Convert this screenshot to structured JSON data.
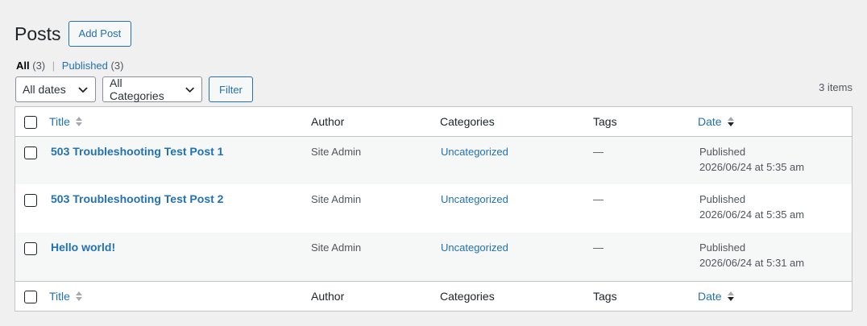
{
  "page": {
    "title": "Posts",
    "add_label": "Add Post"
  },
  "views": {
    "all_label": "All",
    "all_count": "(3)",
    "separator": "|",
    "published_label": "Published",
    "published_count": "(3)"
  },
  "filters": {
    "dates": "All dates",
    "categories": "All Categories",
    "filter_label": "Filter"
  },
  "items_count": "3 items",
  "columns": {
    "title": "Title",
    "author": "Author",
    "categories": "Categories",
    "tags": "Tags",
    "date": "Date"
  },
  "posts": [
    {
      "title": "503 Troubleshooting Test Post 1",
      "author": "Site Admin",
      "category": "Uncategorized",
      "tags": "—",
      "status": "Published",
      "date": "2026/06/24 at 5:35 am"
    },
    {
      "title": "503 Troubleshooting Test Post 2",
      "author": "Site Admin",
      "category": "Uncategorized",
      "tags": "—",
      "status": "Published",
      "date": "2026/06/24 at 5:35 am"
    },
    {
      "title": "Hello world!",
      "author": "Site Admin",
      "category": "Uncategorized",
      "tags": "—",
      "status": "Published",
      "date": "2026/06/24 at 5:31 am"
    }
  ],
  "colors": {
    "link": "#2271b1",
    "text": "#1d2327",
    "muted": "#50575e",
    "border": "#c3c4c7",
    "background": "#f0f0f1"
  }
}
